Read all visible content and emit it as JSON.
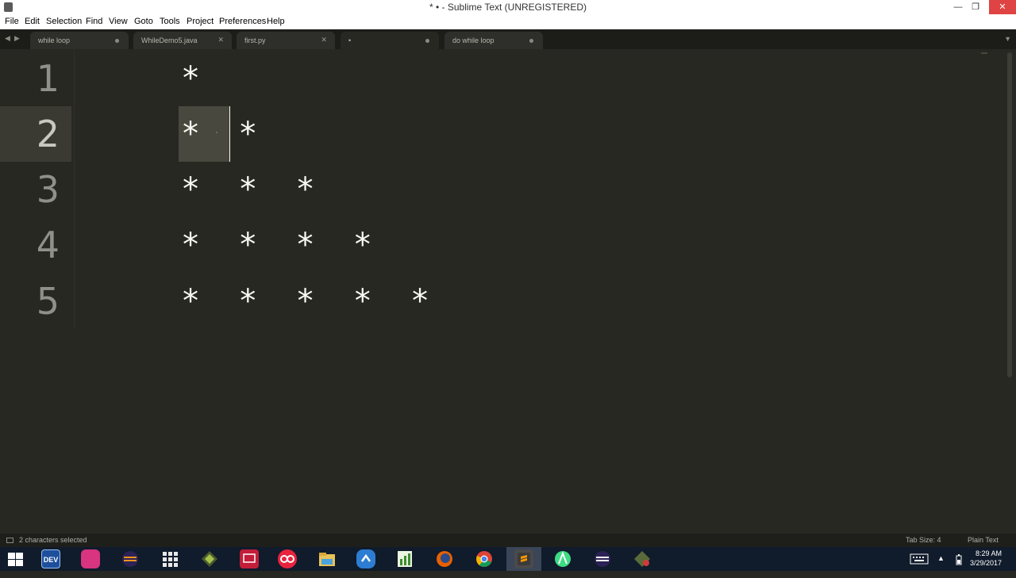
{
  "window": {
    "title": "* • - Sublime Text (UNREGISTERED)",
    "minimize_icon": "minimize-icon",
    "maximize_icon": "restore-icon",
    "close_icon": "close-icon"
  },
  "menu": [
    "File",
    "Edit",
    "Selection",
    "Find",
    "View",
    "Goto",
    "Tools",
    "Project",
    "Preferences",
    "Help"
  ],
  "tabs": [
    {
      "label": "while loop",
      "state": "modified"
    },
    {
      "label": "WhileDemo5.java",
      "state": "close"
    },
    {
      "label": "first.py",
      "state": "close"
    },
    {
      "label": "•",
      "state": "modified",
      "active": true
    },
    {
      "label": "do while loop",
      "state": "modified"
    }
  ],
  "editor": {
    "line_numbers": [
      "1",
      "2",
      "3",
      "4",
      "5"
    ],
    "current_line": 2,
    "lines": [
      "*",
      "*  *",
      "*  *  *",
      "*  *  *  *",
      "*  *  *  *  *"
    ],
    "colors": {
      "background": "#272822",
      "text": "#f8f8f2",
      "gutter": "#8f908a",
      "selection": "#49483e"
    }
  },
  "status": {
    "selection_text": "2 characters selected",
    "tab_size": "Tab Size: 4",
    "syntax": "Plain Text"
  },
  "taskbar": {
    "icons": [
      "windows-start-icon",
      "devcpp-icon",
      "app-icon",
      "eclipse-icon",
      "apps-grid-icon",
      "editor-icon",
      "media-icon",
      "flickr-icon",
      "file-explorer-icon",
      "sync-icon",
      "spreadsheet-icon",
      "firefox-icon",
      "chrome-icon",
      "sublime-text-icon",
      "android-studio-icon",
      "eclipse-icon",
      "tool-icon"
    ],
    "dev_label": "DEV",
    "time": "8:29 AM",
    "date": "3/29/2017"
  }
}
